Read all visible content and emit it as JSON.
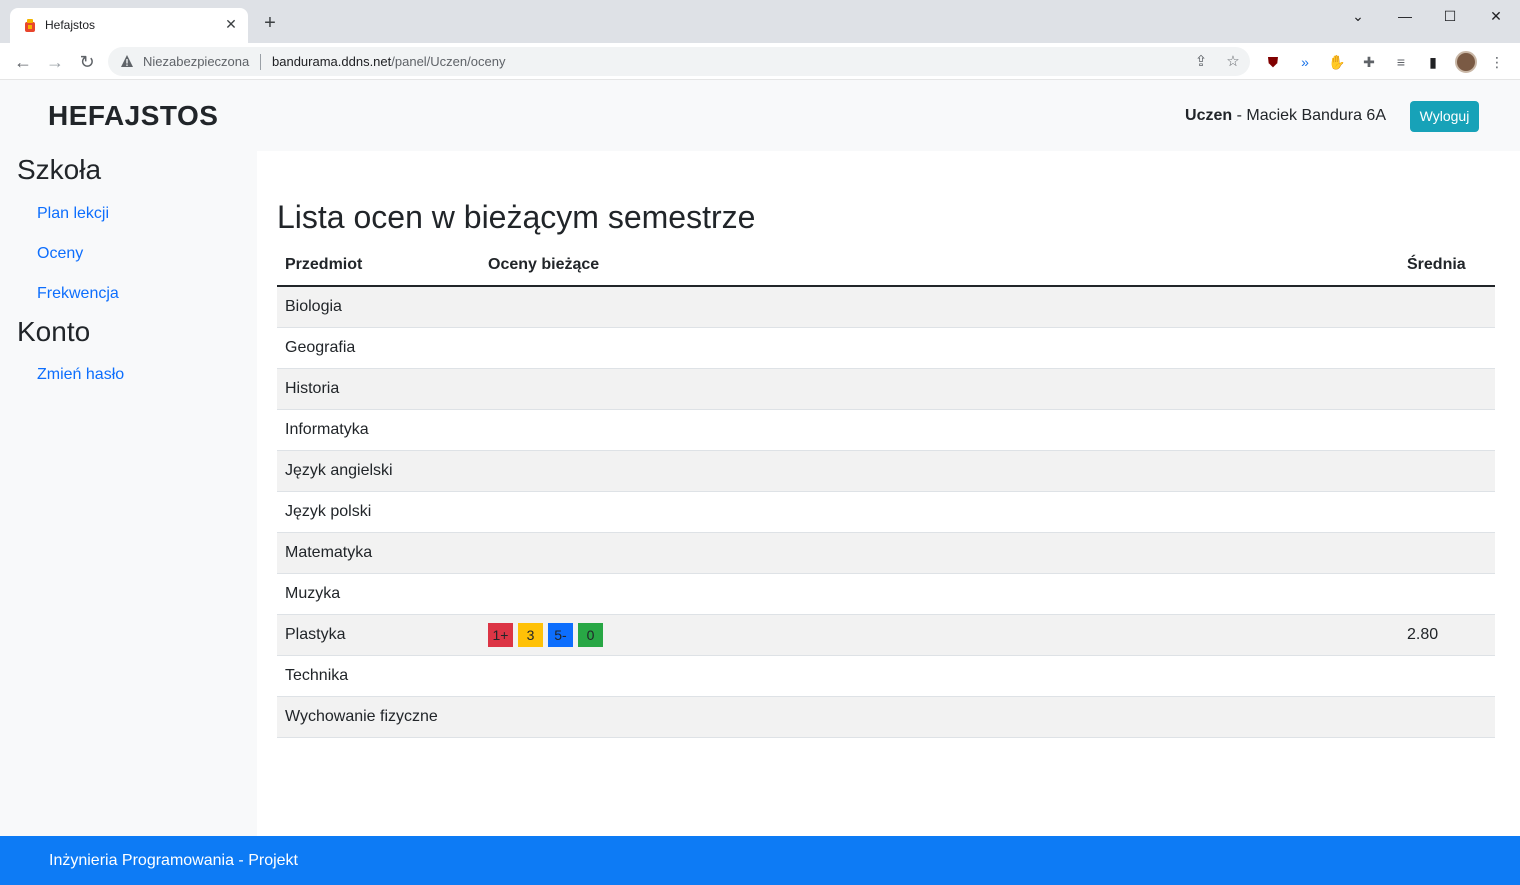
{
  "browser": {
    "tab_title": "Hefajstos",
    "security_label": "Niezabezpieczona",
    "url_host": "bandurama.ddns.net",
    "url_path": "/panel/Uczen/oceny"
  },
  "header": {
    "brand": "HEFAJSTOS",
    "user_role": "Uczen",
    "user_separator": " - ",
    "user_name": "Maciek Bandura 6A",
    "logout_label": "Wyloguj"
  },
  "sidebar": {
    "school_heading": "Szkoła",
    "school_links": [
      "Plan lekcji",
      "Oceny",
      "Frekwencja"
    ],
    "account_heading": "Konto",
    "account_links": [
      "Zmień hasło"
    ]
  },
  "main": {
    "title": "Lista ocen w bieżącym semestrze",
    "columns": [
      "Przedmiot",
      "Oceny bieżące",
      "Średnia"
    ],
    "rows": [
      {
        "subject": "Biologia",
        "grades": [],
        "average": ""
      },
      {
        "subject": "Geografia",
        "grades": [],
        "average": ""
      },
      {
        "subject": "Historia",
        "grades": [],
        "average": ""
      },
      {
        "subject": "Informatyka",
        "grades": [],
        "average": ""
      },
      {
        "subject": "Język angielski",
        "grades": [],
        "average": ""
      },
      {
        "subject": "Język polski",
        "grades": [],
        "average": ""
      },
      {
        "subject": "Matematyka",
        "grades": [],
        "average": ""
      },
      {
        "subject": "Muzyka",
        "grades": [],
        "average": ""
      },
      {
        "subject": "Plastyka",
        "grades": [
          {
            "value": "1+",
            "color": "#dc3545"
          },
          {
            "value": "3",
            "color": "#ffc107"
          },
          {
            "value": "5-",
            "color": "#0d6efd"
          },
          {
            "value": "0",
            "color": "#28a745"
          }
        ],
        "average": "2.80"
      },
      {
        "subject": "Technika",
        "grades": [],
        "average": ""
      },
      {
        "subject": "Wychowanie fizyczne",
        "grades": [],
        "average": ""
      }
    ]
  },
  "footer": {
    "text": "Inżynieria Programowania - Projekt"
  },
  "colors": {
    "accent_info": "#17a2b8",
    "footer_bg": "#0d7bf5",
    "link": "#0d6efd"
  }
}
